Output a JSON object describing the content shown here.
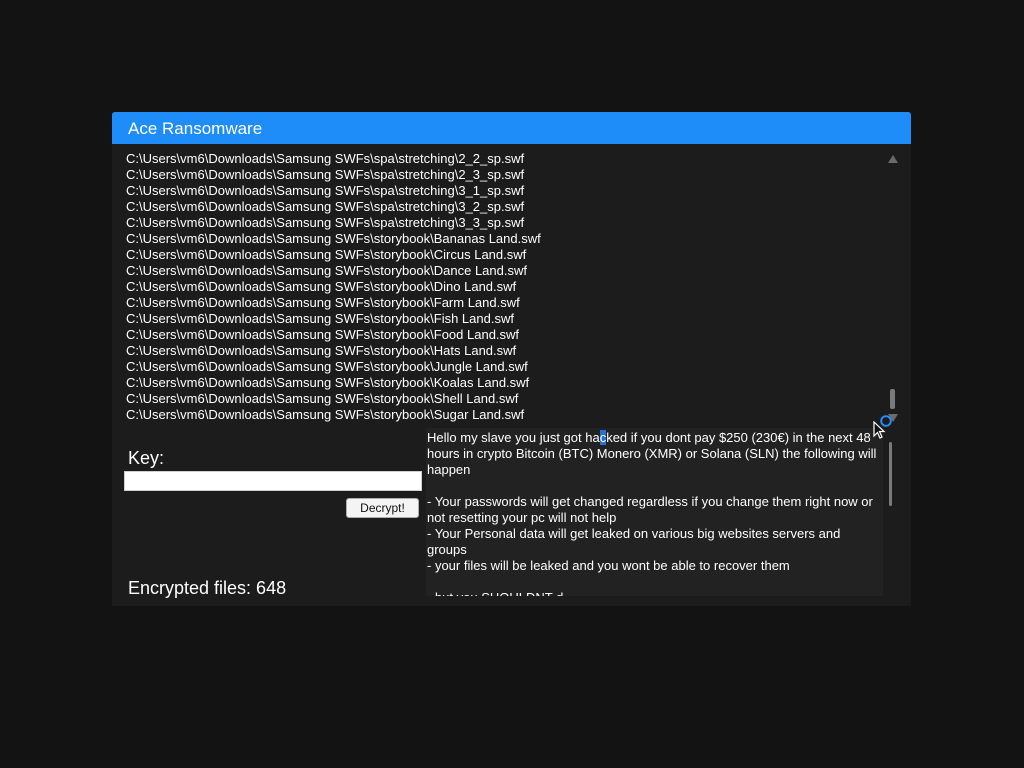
{
  "window": {
    "title": "Ace Ransomware",
    "accent_color": "#1e8dfa",
    "background": "#1c1c1c"
  },
  "file_list": {
    "lines": [
      "C:\\Users\\vm6\\Downloads\\Samsung SWFs\\spa\\stretching\\2_2_sp.swf",
      "C:\\Users\\vm6\\Downloads\\Samsung SWFs\\spa\\stretching\\2_3_sp.swf",
      "C:\\Users\\vm6\\Downloads\\Samsung SWFs\\spa\\stretching\\3_1_sp.swf",
      "C:\\Users\\vm6\\Downloads\\Samsung SWFs\\spa\\stretching\\3_2_sp.swf",
      "C:\\Users\\vm6\\Downloads\\Samsung SWFs\\spa\\stretching\\3_3_sp.swf",
      "C:\\Users\\vm6\\Downloads\\Samsung SWFs\\storybook\\Bananas Land.swf",
      "C:\\Users\\vm6\\Downloads\\Samsung SWFs\\storybook\\Circus Land.swf",
      "C:\\Users\\vm6\\Downloads\\Samsung SWFs\\storybook\\Dance Land.swf",
      "C:\\Users\\vm6\\Downloads\\Samsung SWFs\\storybook\\Dino Land.swf",
      "C:\\Users\\vm6\\Downloads\\Samsung SWFs\\storybook\\Farm Land.swf",
      "C:\\Users\\vm6\\Downloads\\Samsung SWFs\\storybook\\Fish Land.swf",
      "C:\\Users\\vm6\\Downloads\\Samsung SWFs\\storybook\\Food Land.swf",
      "C:\\Users\\vm6\\Downloads\\Samsung SWFs\\storybook\\Hats Land.swf",
      "C:\\Users\\vm6\\Downloads\\Samsung SWFs\\storybook\\Jungle Land.swf",
      "C:\\Users\\vm6\\Downloads\\Samsung SWFs\\storybook\\Koalas Land.swf",
      "C:\\Users\\vm6\\Downloads\\Samsung SWFs\\storybook\\Shell Land.swf",
      "C:\\Users\\vm6\\Downloads\\Samsung SWFs\\storybook\\Sugar Land.swf"
    ],
    "scroll_position_fraction": 0.95
  },
  "key": {
    "label": "Key:",
    "value": "",
    "placeholder": ""
  },
  "decrypt_button": {
    "label": "Decrypt!"
  },
  "encrypted_files": {
    "label": "Encrypted files: 648"
  },
  "ransom_note": {
    "before_selection": "Hello my slave you just got ha",
    "selected": "c",
    "after_selection": "ked if you dont pay $250 (230€) in the next 48 hours in crypto Bitcoin (BTC) Monero (XMR) or Solana (SLN) the following will happen\n\n- Your passwords will get changed regardless if you change them right now or not resetting your pc will not help\n- Your Personal data will get leaked on various big websites servers and groups\n- your files will be leaked and you wont be able to recover them\n\n- but you SHOULDNT d",
    "selection_color": "#2a6fd6"
  },
  "icons": {
    "scroll_up": "triangle-up",
    "scroll_down": "triangle-down",
    "cursor": "arrow-pointer"
  }
}
